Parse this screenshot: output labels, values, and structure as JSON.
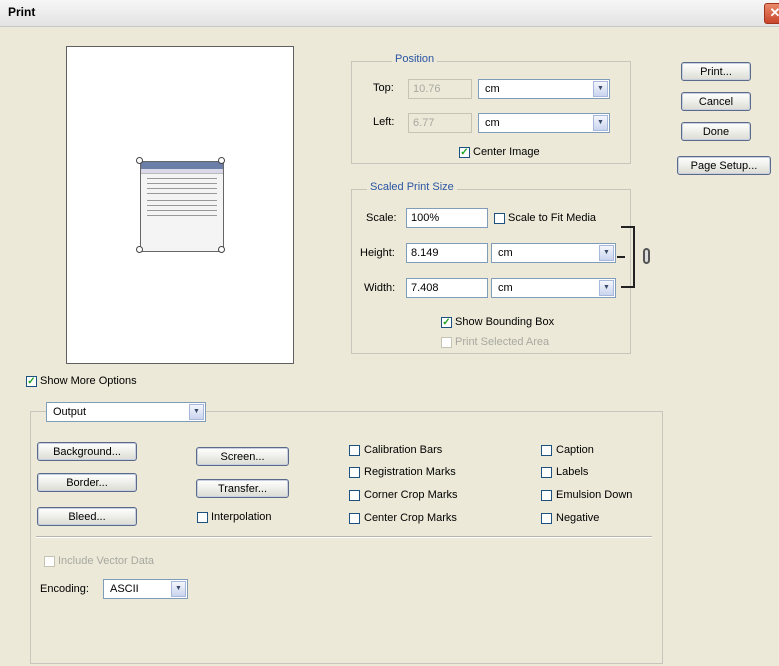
{
  "window": {
    "title": "Print"
  },
  "buttons": {
    "print": "Print...",
    "cancel": "Cancel",
    "done": "Done",
    "page_setup": "Page Setup..."
  },
  "position": {
    "legend": "Position",
    "top_label": "Top:",
    "top_value": "10.76",
    "top_unit": "cm",
    "left_label": "Left:",
    "left_value": "6.77",
    "left_unit": "cm",
    "center_image": "Center Image",
    "center_image_checked": true
  },
  "scaled": {
    "legend": "Scaled Print Size",
    "scale_label": "Scale:",
    "scale_value": "100%",
    "scale_to_fit": "Scale to Fit Media",
    "height_label": "Height:",
    "height_value": "8.149",
    "height_unit": "cm",
    "width_label": "Width:",
    "width_value": "7.408",
    "width_unit": "cm",
    "show_bbox": "Show Bounding Box",
    "print_selected": "Print Selected Area"
  },
  "more_options": {
    "label": "Show More Options",
    "checked": true,
    "section": "Output",
    "buttons": {
      "background": "Background...",
      "border": "Border...",
      "bleed": "Bleed...",
      "screen": "Screen...",
      "transfer": "Transfer..."
    },
    "interpolation": "Interpolation",
    "checks_col1": [
      "Calibration Bars",
      "Registration Marks",
      "Corner Crop Marks",
      "Center Crop Marks"
    ],
    "checks_col2": [
      "Caption",
      "Labels",
      "Emulsion Down",
      "Negative"
    ],
    "include_vector": "Include Vector Data",
    "encoding_label": "Encoding:",
    "encoding_value": "ASCII"
  },
  "icons": {
    "close": "close-icon",
    "dropdown": "chevron-down-icon",
    "check": "checkmark-icon",
    "link": "chain-link-icon"
  }
}
